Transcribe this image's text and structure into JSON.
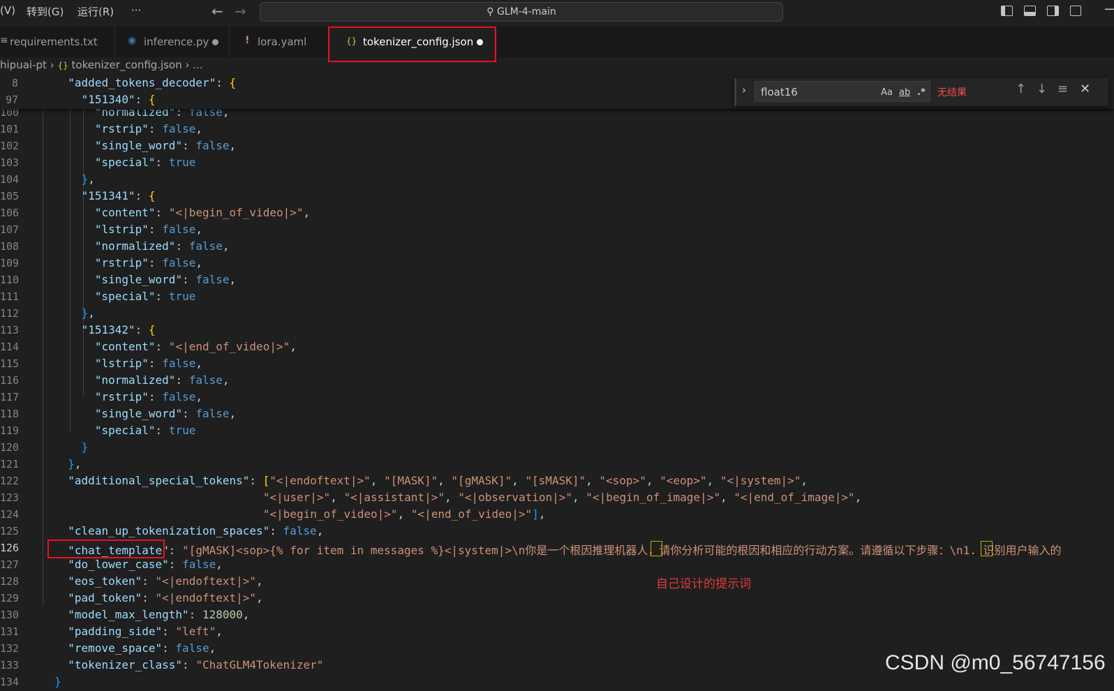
{
  "titlebar": {
    "menu": [
      "(V)",
      "转到(G)",
      "运行(R)",
      "···"
    ],
    "search_text": "GLM-4-main"
  },
  "tabs": [
    {
      "label": "requirements.txt",
      "icon": "text-file-icon",
      "modified": false
    },
    {
      "label": "inference.py",
      "icon": "python-icon",
      "modified": true
    },
    {
      "label": "lora.yaml",
      "icon": "yaml-exclamation-icon",
      "modified": false
    },
    {
      "label": "tokenizer_config.json",
      "icon": "json-braces-icon",
      "modified": true,
      "active": true
    }
  ],
  "breadcrumb": {
    "folder": "hipuai-pt",
    "file": "tokenizer_config.json",
    "more": "..."
  },
  "find": {
    "query": "float16",
    "opt_case": "Aa",
    "opt_word": "ab",
    "opt_regex": ".*",
    "result": "无结果"
  },
  "editor": {
    "sticky": [
      {
        "num": "8",
        "text": "  \"added_tokens_decoder\": {"
      },
      {
        "num": "97",
        "text": "    \"151340\": {"
      }
    ],
    "lines": [
      {
        "num": "100",
        "text": "      \"normalized\": false,"
      },
      {
        "num": "101",
        "text": "      \"rstrip\": false,"
      },
      {
        "num": "102",
        "text": "      \"single_word\": false,"
      },
      {
        "num": "103",
        "text": "      \"special\": true"
      },
      {
        "num": "104",
        "text": "    },"
      },
      {
        "num": "105",
        "text": "    \"151341\": {"
      },
      {
        "num": "106",
        "text": "      \"content\": \"<|begin_of_video|>\","
      },
      {
        "num": "107",
        "text": "      \"lstrip\": false,"
      },
      {
        "num": "108",
        "text": "      \"normalized\": false,"
      },
      {
        "num": "109",
        "text": "      \"rstrip\": false,"
      },
      {
        "num": "110",
        "text": "      \"single_word\": false,"
      },
      {
        "num": "111",
        "text": "      \"special\": true"
      },
      {
        "num": "112",
        "text": "    },"
      },
      {
        "num": "113",
        "text": "    \"151342\": {"
      },
      {
        "num": "114",
        "text": "      \"content\": \"<|end_of_video|>\","
      },
      {
        "num": "115",
        "text": "      \"lstrip\": false,"
      },
      {
        "num": "116",
        "text": "      \"normalized\": false,"
      },
      {
        "num": "117",
        "text": "      \"rstrip\": false,"
      },
      {
        "num": "118",
        "text": "      \"single_word\": false,"
      },
      {
        "num": "119",
        "text": "      \"special\": true"
      },
      {
        "num": "120",
        "text": "    }"
      },
      {
        "num": "121",
        "text": "  },"
      },
      {
        "num": "122",
        "text": "  \"additional_special_tokens\": [\"<|endoftext|>\", \"[MASK]\", \"[gMASK]\", \"[sMASK]\", \"<sop>\", \"<eop>\", \"<|system|>\","
      },
      {
        "num": "123",
        "text": "                               \"<|user|>\", \"<|assistant|>\", \"<|observation|>\", \"<|begin_of_image|>\", \"<|end_of_image|>\","
      },
      {
        "num": "124",
        "text": "                               \"<|begin_of_video|>\", \"<|end_of_video|>\"],"
      },
      {
        "num": "125",
        "text": "  \"clean_up_tokenization_spaces\": false,"
      },
      {
        "num": "126",
        "text": "  \"chat_template\": \"[gMASK]<sop>{% for item in messages %}<|system|>\\n你是一个根因推理机器人，请你分析可能的根因和相应的行动方案。请遵循以下步骤：\\n1. 识别用户输入的"
      },
      {
        "num": "127",
        "text": "  \"do_lower_case\": false,"
      },
      {
        "num": "128",
        "text": "  \"eos_token\": \"<|endoftext|>\","
      },
      {
        "num": "129",
        "text": "  \"pad_token\": \"<|endoftext|>\","
      },
      {
        "num": "130",
        "text": "  \"model_max_length\": 128000,"
      },
      {
        "num": "131",
        "text": "  \"padding_side\": \"left\","
      },
      {
        "num": "132",
        "text": "  \"remove_space\": false,"
      },
      {
        "num": "133",
        "text": "  \"tokenizer_class\": \"ChatGLM4Tokenizer\""
      },
      {
        "num": "134",
        "text": "}"
      }
    ],
    "current_line": "126"
  },
  "annotation": "自己设计的提示词",
  "watermark": "CSDN @m0_56747156"
}
